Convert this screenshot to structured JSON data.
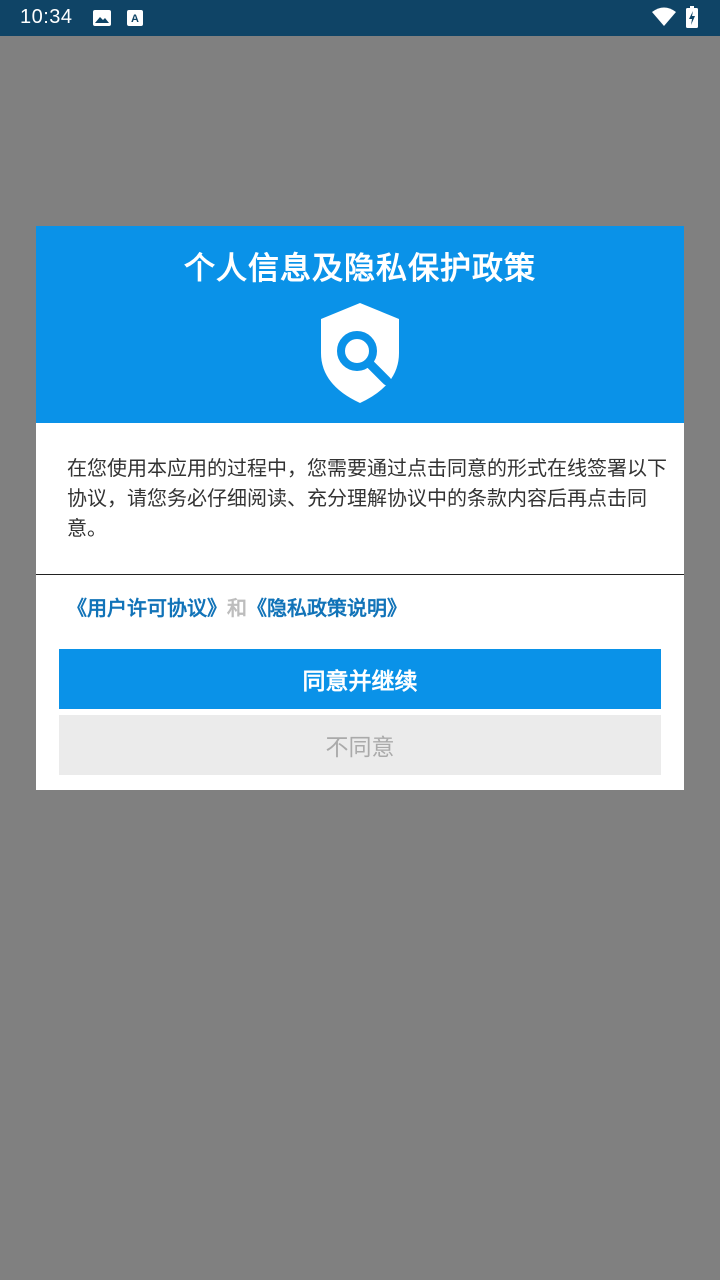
{
  "status_bar": {
    "time": "10:34",
    "icons_left": [
      "image-icon",
      "a-icon"
    ],
    "icons_right": [
      "wifi-icon",
      "battery-charging-icon"
    ]
  },
  "dialog": {
    "title": "个人信息及隐私保护政策",
    "header_icon": "shield-search-icon",
    "body": "在您使用本应用的过程中，您需要通过点击同意的形式在线签署以下协议，请您务必仔细阅读、充分理解协议中的条款内容后再点击同意。",
    "link_user_agreement": "《用户许可协议》",
    "link_and": "和",
    "link_privacy_policy": "《隐私政策说明》",
    "agree_button": "同意并继续",
    "disagree_button": "不同意"
  },
  "colors": {
    "status_bar": "#0f4466",
    "accent": "#0a92e8",
    "link": "#1173b8",
    "overlay": "#808080"
  }
}
